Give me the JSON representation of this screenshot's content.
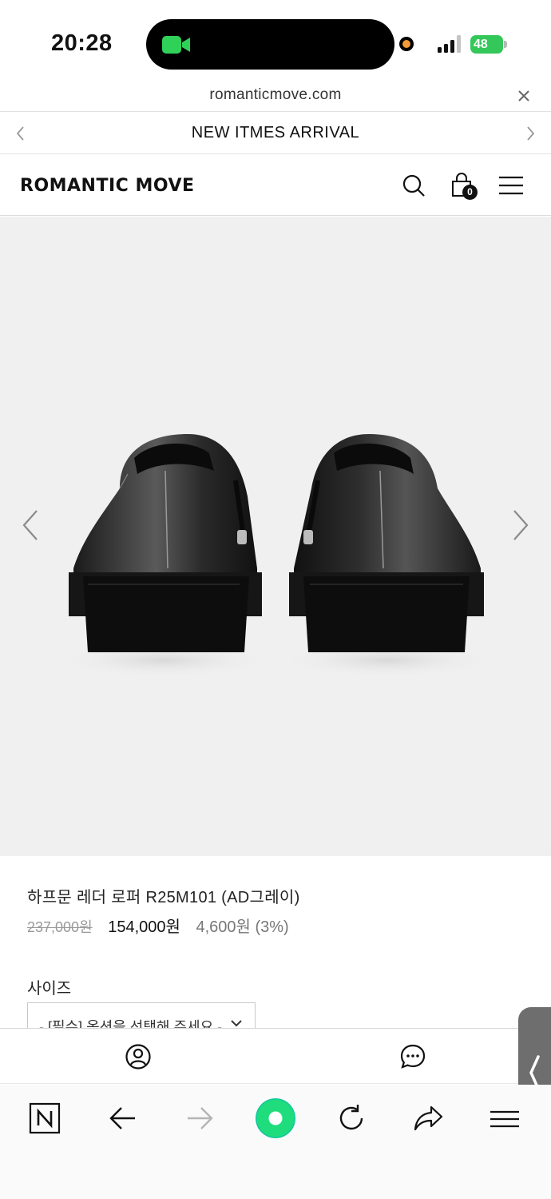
{
  "status_bar": {
    "time": "20:28",
    "battery": "48",
    "icons": [
      "facetime-video-icon",
      "recording-dot-icon",
      "signal-icon",
      "battery-icon"
    ],
    "colors": {
      "facetime": "#30d158",
      "recording": "#f29b38",
      "battery": "#34c759"
    }
  },
  "browser": {
    "url": "romanticmove.com"
  },
  "announcement": {
    "text": "NEW ITMES ARRIVAL"
  },
  "header": {
    "logo": "ROMANTIC MOVE",
    "cart_count": "0",
    "icons": [
      "search-icon",
      "cart-icon",
      "menu-icon"
    ]
  },
  "product": {
    "image_description_icon": "loafer-shoes-image",
    "title": "하프문 레더 로퍼 R25M101 (AD그레이)",
    "original_price": "237,000원",
    "sale_price": "154,000원",
    "points": "4,600원 (3%)",
    "option_label": "사이즈",
    "option_placeholder": "- [필수] 옵션을 선택해 주세요 -"
  },
  "site_actions": {
    "icons": [
      "user-icon",
      "chat-icon"
    ]
  },
  "browser_toolbar": {
    "icons": [
      "naver-n-icon",
      "back-arrow-icon",
      "forward-arrow-icon",
      "home-orb-icon",
      "reload-icon",
      "share-icon",
      "menu-icon"
    ]
  }
}
